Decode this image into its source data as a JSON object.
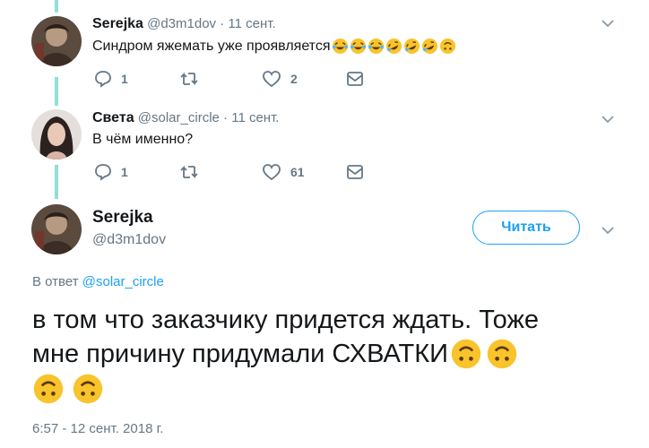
{
  "tweet1": {
    "name": "Serejka",
    "handle": "@d3m1dov",
    "separator": "·",
    "date": "11 сент.",
    "text": "Синдром яжемать уже проявляется",
    "replies": "1",
    "retweets": "",
    "likes": "2",
    "icons": [
      "reply-icon",
      "retweet-icon",
      "like-icon",
      "message-icon",
      "chevron-down-icon"
    ]
  },
  "tweet2": {
    "name": "Света",
    "handle": "@solar_circle",
    "separator": "·",
    "date": "11 сент.",
    "text": "В чём именно?",
    "replies": "1",
    "retweets": "",
    "likes": "61"
  },
  "main": {
    "name": "Serejka",
    "handle": "@d3m1dov",
    "follow_label": "Читать",
    "reply_prefix": "В ответ",
    "reply_handle": "@solar_circle",
    "text_line1": "в том что заказчику придется ждать. Тоже",
    "text_line2": "мне причину придумали СХВАТКИ",
    "timestamp": "6:57 - 12 сент. 2018 г."
  },
  "colors": {
    "accent": "#1da1f2",
    "thread_line": "#8fe0d6",
    "muted": "#657786",
    "text": "#14171a"
  }
}
